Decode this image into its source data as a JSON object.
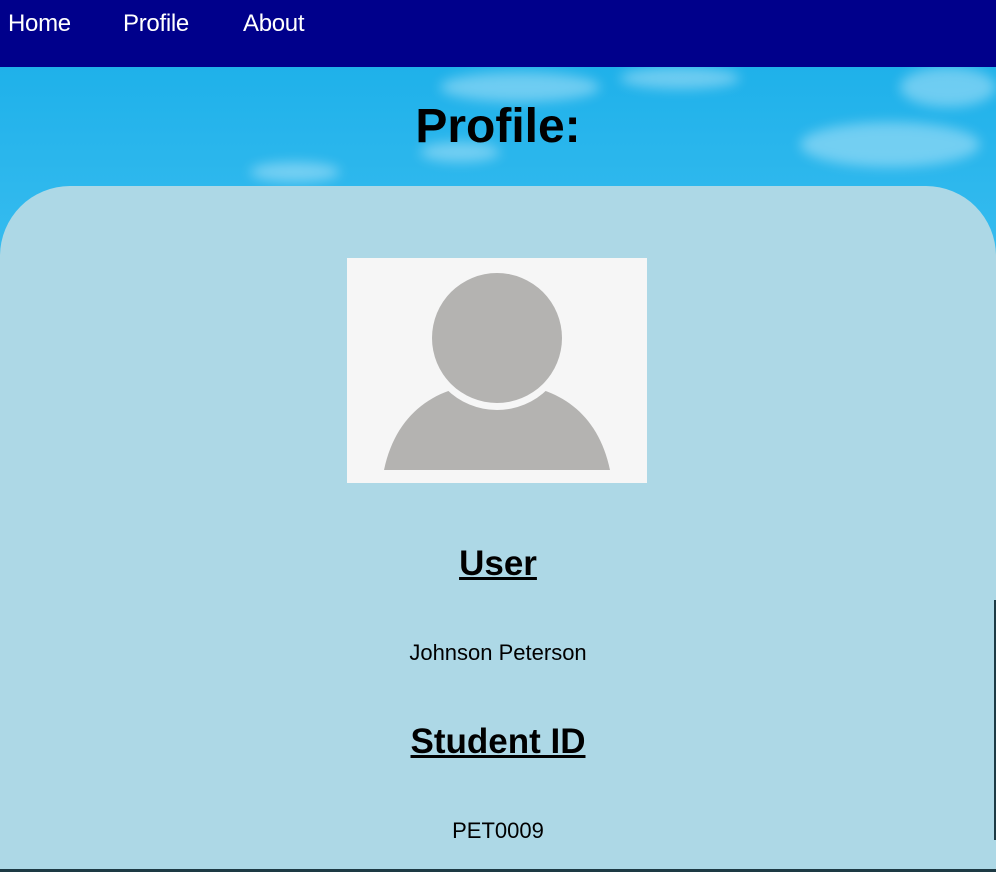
{
  "nav": {
    "items": [
      {
        "label": "Home"
      },
      {
        "label": "Profile"
      },
      {
        "label": "About"
      }
    ]
  },
  "page": {
    "title": "Profile:"
  },
  "profile": {
    "avatar_icon": "user-silhouette-icon",
    "user_heading": "User",
    "user_name": "Johnson Peterson",
    "id_heading": "Student ID",
    "student_id": "PET0009"
  },
  "colors": {
    "nav_bg": "#00008b",
    "card_bg": "#add8e6",
    "avatar_bg": "#f6f6f6",
    "avatar_fg": "#b4b3b1"
  }
}
